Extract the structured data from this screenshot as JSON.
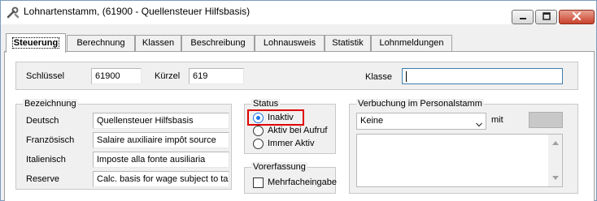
{
  "window": {
    "title": "Lohnartenstamm, (61900 - Quellensteuer Hilfsbasis)"
  },
  "tabs": [
    {
      "label": "Steuerung",
      "active": true
    },
    {
      "label": "Berechnung"
    },
    {
      "label": "Klassen"
    },
    {
      "label": "Beschreibung"
    },
    {
      "label": "Lohnausweis"
    },
    {
      "label": "Statistik"
    },
    {
      "label": "Lohnmeldungen"
    }
  ],
  "header": {
    "schluessel_label": "Schlüssel",
    "schluessel_value": "61900",
    "kuerzel_label": "Kürzel",
    "kuerzel_value": "619",
    "klasse_label": "Klasse",
    "klasse_value": ""
  },
  "bezeichnung": {
    "legend": "Bezeichnung",
    "rows": [
      {
        "label": "Deutsch",
        "value": "Quellensteuer Hilfsbasis"
      },
      {
        "label": "Französisch",
        "value": "Salaire auxiliaire impôt source"
      },
      {
        "label": "Italienisch",
        "value": "Imposte alla fonte ausiliaria"
      },
      {
        "label": "Reserve",
        "value": "Calc. basis for wage subject to tax"
      }
    ]
  },
  "status": {
    "legend": "Status",
    "options": [
      {
        "label": "Inaktiv",
        "selected": true
      },
      {
        "label": "Aktiv bei Aufruf",
        "selected": false
      },
      {
        "label": "Immer Aktiv",
        "selected": false
      }
    ]
  },
  "vorerfassung": {
    "legend": "Vorerfassung",
    "checkbox_label": "Mehrfacheingabe",
    "checked": false
  },
  "verbuchung": {
    "legend": "Verbuchung im Personalstamm",
    "combo_value": "Keine",
    "mit_label": "mit"
  },
  "colors": {
    "highlight": "#e00000",
    "radio_selected": "#1a73e8",
    "window_border": "#7a9cbf"
  },
  "icons": [
    "tools-icon",
    "minimize-icon",
    "maximize-icon",
    "close-icon",
    "chevron-down-icon",
    "scroll-up-icon",
    "scroll-down-icon"
  ]
}
